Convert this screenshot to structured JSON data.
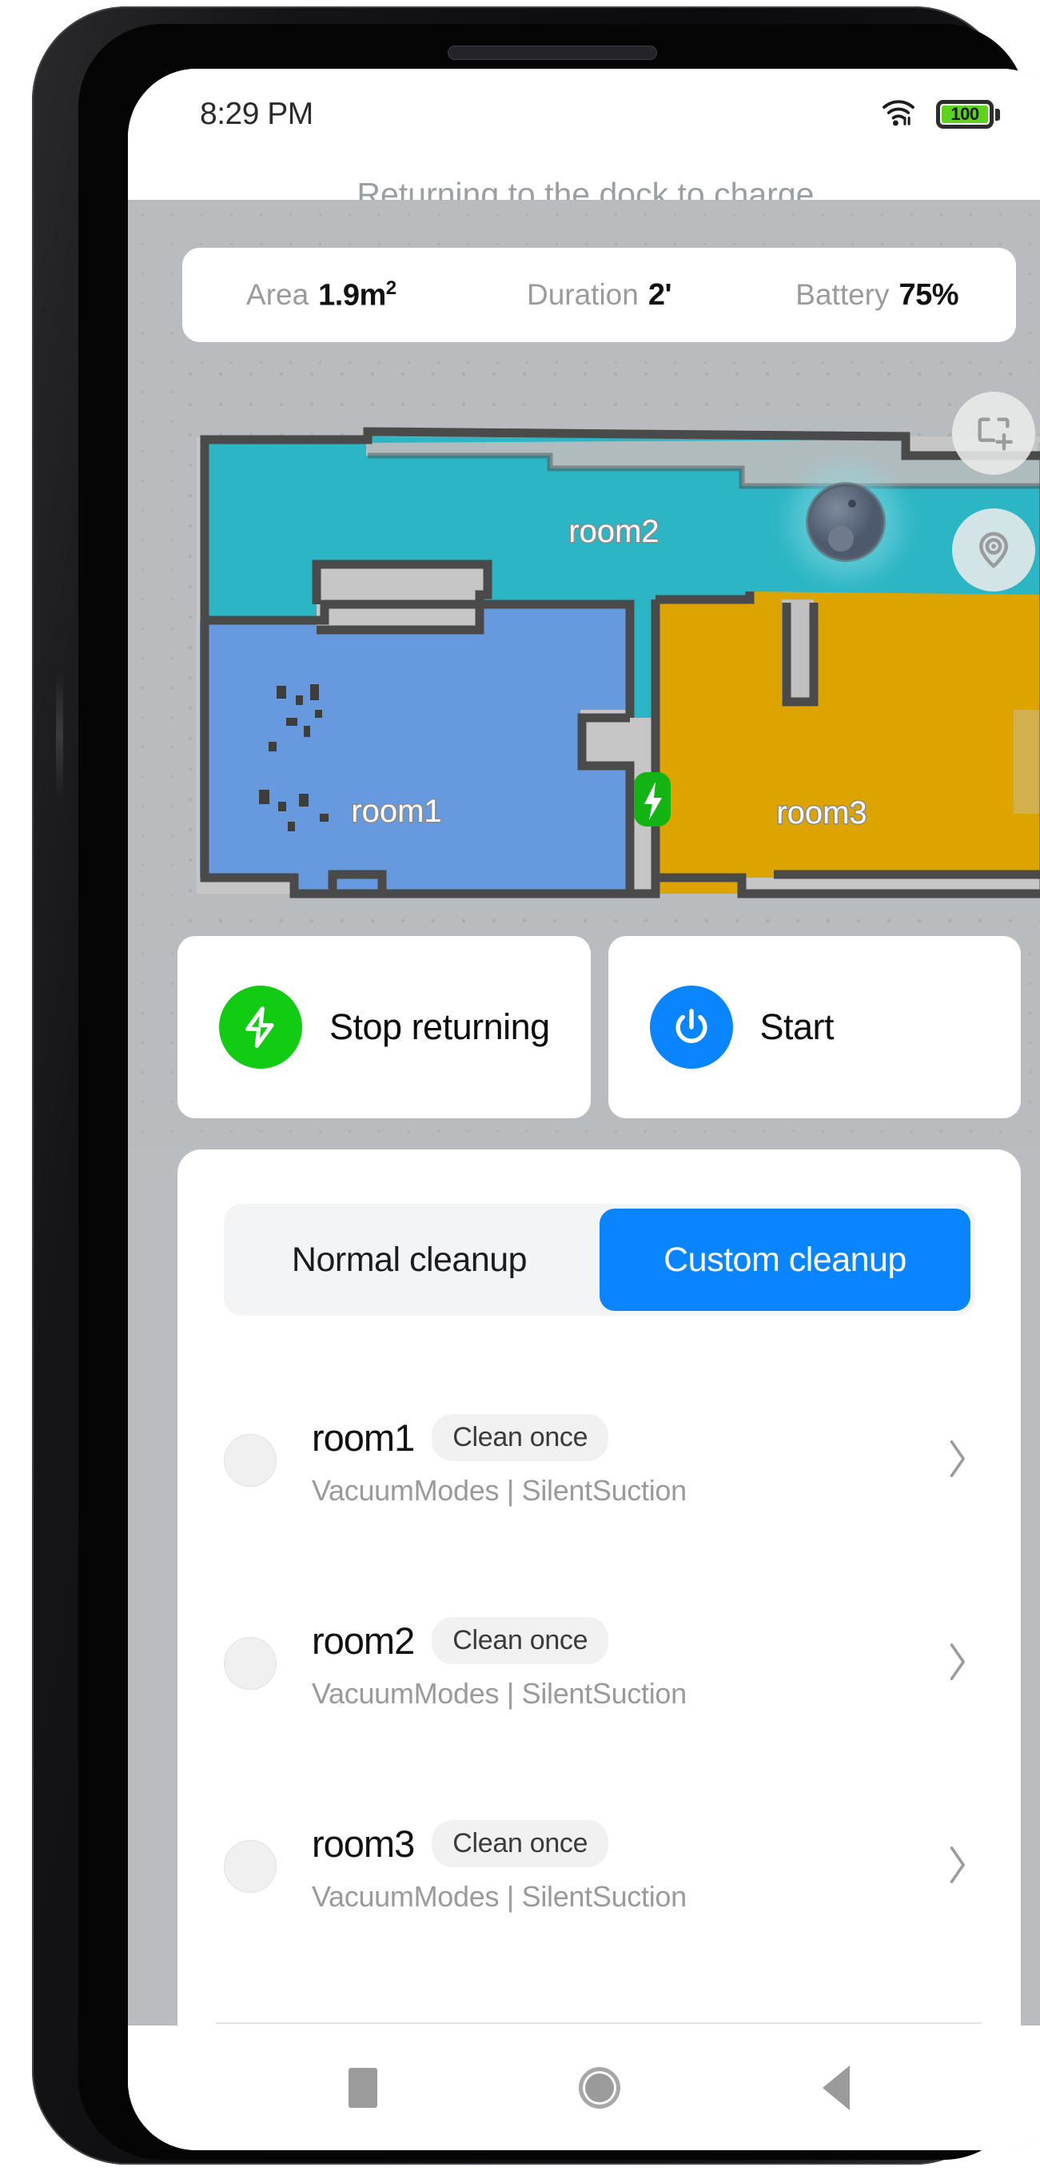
{
  "statusbar": {
    "time": "8:29 PM",
    "wifi_icon": "wifi-icon",
    "battery_icon": "battery-icon",
    "battery_level": "100"
  },
  "header": {
    "status_title": "Returning to the dock to charge..."
  },
  "stats": [
    {
      "label": "Area",
      "value": "1.9m",
      "sup": "2"
    },
    {
      "label": "Duration",
      "value": "2'",
      "sup": ""
    },
    {
      "label": "Battery",
      "value": "75%",
      "sup": ""
    }
  ],
  "map": {
    "rooms": [
      {
        "name": "room1",
        "color": "#6699dd"
      },
      {
        "name": "room2",
        "color": "#2cb5c4"
      },
      {
        "name": "room3",
        "color": "#dda400"
      }
    ],
    "wall_color": "#4a4a4a",
    "floor_color": "#c4c4c4",
    "background_color": "#b8bcbf",
    "robot_icon": "robot-vacuum-icon",
    "dock_icon": "charging-dock-icon",
    "fab_zone_icon": "add-zone-icon",
    "fab_pin_icon": "location-pin-icon"
  },
  "actions": [
    {
      "label": "Stop returning",
      "icon": "lightning-bolt-icon",
      "color": "#12cc13"
    },
    {
      "label": "Start",
      "icon": "power-icon",
      "color": "#0a84ff"
    }
  ],
  "cleanup_tabs": [
    {
      "label": "Normal cleanup",
      "active": false
    },
    {
      "label": "Custom cleanup",
      "active": true
    }
  ],
  "room_list": [
    {
      "name": "room1",
      "chip": "Clean once",
      "subtitle": "VacuumModes  |  SilentSuction",
      "selected": false
    },
    {
      "name": "room2",
      "chip": "Clean once",
      "subtitle": "VacuumModes  |  SilentSuction",
      "selected": false
    },
    {
      "name": "room3",
      "chip": "Clean once",
      "subtitle": "VacuumModes  |  SilentSuction",
      "selected": false
    }
  ],
  "navbar": [
    {
      "icon": "recents-square-icon"
    },
    {
      "icon": "home-circle-icon"
    },
    {
      "icon": "back-triangle-icon"
    }
  ],
  "colors": {
    "accent_blue": "#0a84ff",
    "accent_green": "#12cc13",
    "room1": "#6699dd",
    "room2": "#2cb5c4",
    "room3": "#dda400"
  }
}
